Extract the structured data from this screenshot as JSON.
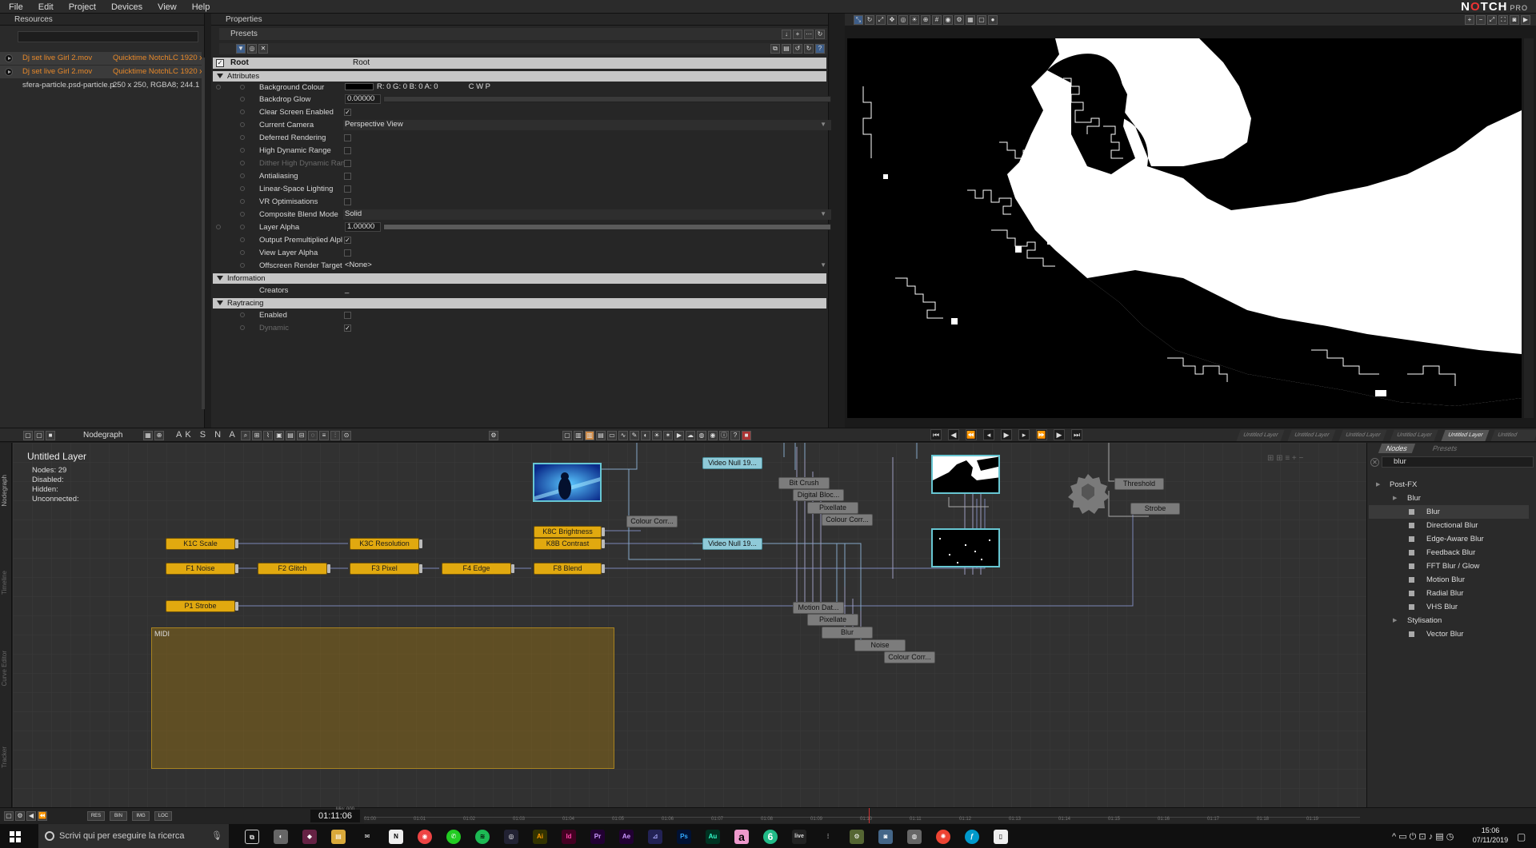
{
  "menu": [
    "File",
    "Edit",
    "Project",
    "Devices",
    "View",
    "Help"
  ],
  "logo": {
    "word_pre": "N",
    "word_o": "O",
    "word_post": "TCH",
    "edition": "PRO"
  },
  "resources": {
    "title": "Resources",
    "items": [
      {
        "name": "Dj set live Girl 2.mov",
        "meta": "Quicktime NotchLC 1920 x",
        "selected": true
      },
      {
        "name": "Dj set live Girl 2.mov",
        "meta": "Quicktime NotchLC 1920 x",
        "selected": true
      },
      {
        "name": "sfera-particle.psd-particle.p",
        "meta": "250 x 250, RGBA8; 244.1 kB,",
        "selected": false
      }
    ]
  },
  "properties": {
    "title": "Properties",
    "presets": "Presets",
    "root_label": "Root",
    "root_value": "Root",
    "sections": {
      "attributes": "Attributes",
      "information": "Information",
      "raytracing": "Raytracing"
    },
    "rows": {
      "bg_colour": {
        "label": "Background Colour",
        "value": "R: 0 G: 0 B: 0 A: 0",
        "channels": "C   W   P"
      },
      "backdrop_glow": {
        "label": "Backdrop Glow",
        "value": "0.00000"
      },
      "clear_screen": {
        "label": "Clear Screen Enabled"
      },
      "current_camera": {
        "label": "Current Camera",
        "value": "Perspective View"
      },
      "deferred": {
        "label": "Deferred Rendering"
      },
      "hdr": {
        "label": "High Dynamic Range"
      },
      "dither": {
        "label": "Dither High Dynamic Ran"
      },
      "antialias": {
        "label": "Antialiasing"
      },
      "linear": {
        "label": "Linear-Space Lighting"
      },
      "vr": {
        "label": "VR Optimisations"
      },
      "blend": {
        "label": "Composite Blend Mode",
        "value": "Solid"
      },
      "alpha": {
        "label": "Layer Alpha",
        "value": "1.00000"
      },
      "premult": {
        "label": "Output Premultiplied Alpl"
      },
      "view_alpha": {
        "label": "View Layer Alpha"
      },
      "offscreen": {
        "label": "Offscreen Render Target",
        "value": "<None>"
      },
      "creators": {
        "label": "Creators",
        "value": "_"
      },
      "rt_enabled": {
        "label": "Enabled"
      },
      "rt_dynamic": {
        "label": "Dynamic"
      }
    }
  },
  "toolbar": {
    "nodegraph_label": "Nodegraph",
    "snap": "AK S N A P"
  },
  "layer_tabs": [
    "Untitled Layer",
    "Untitled Layer",
    "Untitled Layer",
    "Untitled Layer",
    "Untitled Layer",
    "Untitled Layer"
  ],
  "side_tabs": [
    "Nodegraph",
    "Timeline",
    "Curve Editor",
    "Tracker"
  ],
  "nodegraph": {
    "title": "Untitled  Layer",
    "stats": [
      "Nodes:  29",
      "Disabled:",
      "Hidden:",
      "Unconnected:"
    ],
    "group_label": "MIDI",
    "nodes": {
      "k1c": "K1C  Scale",
      "k3c": "K3C  Resolution",
      "k8c": "K8C  Brightness",
      "k8b": "K8B  Contrast",
      "f1": "F1  Noise",
      "f2": "F2  Glitch",
      "f3": "F3  Pixel",
      "f4": "F4  Edge",
      "f8": "F8  Blend",
      "p1": "P1  Strobe",
      "vn1": "Video  Null  19...",
      "vn2": "Video  Null  19...",
      "bitcrush": "Bit  Crush",
      "digital": "Digital  Bloc...",
      "pixellate1": "Pixellate",
      "colcorr1": "Colour  Corr...",
      "colcorr0": "Colour  Corr...",
      "motion": "Motion  Dat...",
      "pixellate2": "Pixellate",
      "blur": "Blur",
      "noise": "Noise",
      "colcorr2": "Colour  Corr...",
      "threshold": "Threshold",
      "strobe": "Strobe"
    }
  },
  "nodes_panel": {
    "tabs": [
      "Nodes",
      "Presets"
    ],
    "search": "blur",
    "tree": [
      {
        "label": "Post-FX",
        "level": 0
      },
      {
        "label": "Blur",
        "level": 1
      },
      {
        "label": "Blur",
        "level": 2,
        "selected": true
      },
      {
        "label": "Directional Blur",
        "level": 2
      },
      {
        "label": "Edge-Aware Blur",
        "level": 2
      },
      {
        "label": "Feedback Blur",
        "level": 2
      },
      {
        "label": "FFT Blur / Glow",
        "level": 2
      },
      {
        "label": "Motion Blur",
        "level": 2
      },
      {
        "label": "Radial Blur",
        "level": 2
      },
      {
        "label": "VHS Blur",
        "level": 2
      },
      {
        "label": "Stylisation",
        "level": 1
      },
      {
        "label": "Vector Blur",
        "level": 2
      }
    ]
  },
  "timeline": {
    "time": "01:11:06",
    "buttons": [
      "RES",
      "BIN",
      "IMG",
      "LOC"
    ],
    "ticks": [
      "01:00",
      "01:01",
      "01:02",
      "01:03",
      "01:04",
      "01:05",
      "01:06",
      "01:07",
      "01:08",
      "01:09",
      "01:10",
      "01:11",
      "01:12",
      "01:13",
      "01:14",
      "01:15",
      "01:16",
      "01:17",
      "01:18",
      "01:19"
    ],
    "mode": "Min: 000"
  },
  "taskbar": {
    "search": "Scrivi qui per eseguire la ricerca",
    "time": "15:06",
    "date": "07/11/2019"
  }
}
